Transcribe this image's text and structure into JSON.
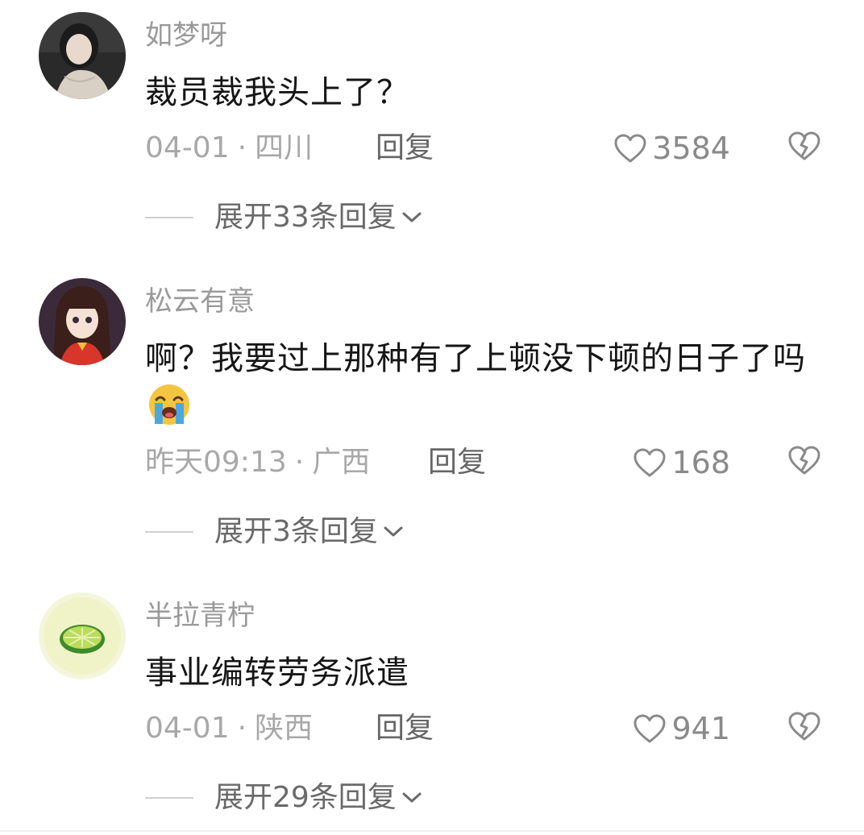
{
  "comments": [
    {
      "username": "如梦呀",
      "text": "裁员裁我头上了？",
      "date": "04-01",
      "location": "四川",
      "reply_label": "回复",
      "likes": "3584",
      "expand_label": "展开33条回复"
    },
    {
      "username": "松云有意",
      "text": "啊？我要过上那种有了上顿没下顿的日子了吗",
      "date": "昨天09:13",
      "location": "广西",
      "reply_label": "回复",
      "likes": "168",
      "expand_label": "展开3条回复"
    },
    {
      "username": "半拉青柠",
      "text": "事业编转劳务派遣",
      "date": "04-01",
      "location": "陕西",
      "reply_label": "回复",
      "likes": "941",
      "expand_label": "展开29条回复"
    }
  ],
  "separator": "·",
  "colors": {
    "username": "#9a9a9a",
    "text": "#161616",
    "meta": "#a8a8a8",
    "icon": "#8a8a8a"
  }
}
